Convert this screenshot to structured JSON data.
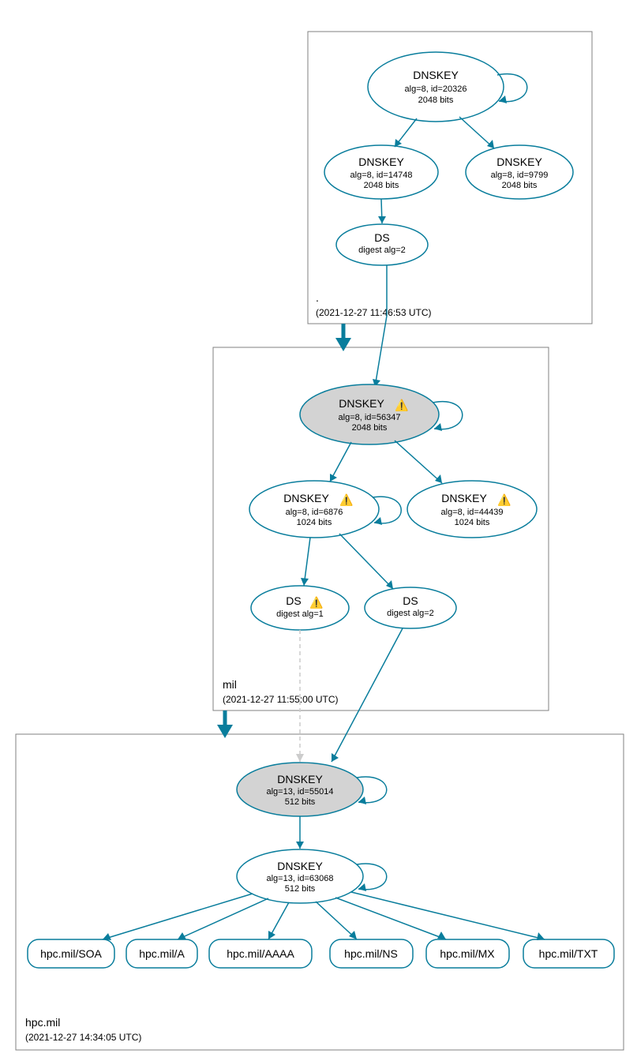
{
  "zones": {
    "root": {
      "label": ".",
      "timestamp": "(2021-12-27 11:46:53 UTC)"
    },
    "mil": {
      "label": "mil",
      "timestamp": "(2021-12-27 11:55:00 UTC)"
    },
    "hpc": {
      "label": "hpc.mil",
      "timestamp": "(2021-12-27 14:34:05 UTC)"
    }
  },
  "nodes": {
    "root_ksk": {
      "title": "DNSKEY",
      "l1": "alg=8, id=20326",
      "l2": "2048 bits",
      "warn": false
    },
    "root_zsk1": {
      "title": "DNSKEY",
      "l1": "alg=8, id=14748",
      "l2": "2048 bits",
      "warn": false
    },
    "root_zsk2": {
      "title": "DNSKEY",
      "l1": "alg=8, id=9799",
      "l2": "2048 bits",
      "warn": false
    },
    "root_ds": {
      "title": "DS",
      "l1": "digest alg=2",
      "l2": "",
      "warn": false
    },
    "mil_ksk": {
      "title": "DNSKEY",
      "l1": "alg=8, id=56347",
      "l2": "2048 bits",
      "warn": true
    },
    "mil_zsk1": {
      "title": "DNSKEY",
      "l1": "alg=8, id=6876",
      "l2": "1024 bits",
      "warn": true
    },
    "mil_zsk2": {
      "title": "DNSKEY",
      "l1": "alg=8, id=44439",
      "l2": "1024 bits",
      "warn": true
    },
    "mil_ds1": {
      "title": "DS",
      "l1": "digest alg=1",
      "l2": "",
      "warn": true
    },
    "mil_ds2": {
      "title": "DS",
      "l1": "digest alg=2",
      "l2": "",
      "warn": false
    },
    "hpc_ksk": {
      "title": "DNSKEY",
      "l1": "alg=13, id=55014",
      "l2": "512 bits",
      "warn": false
    },
    "hpc_zsk": {
      "title": "DNSKEY",
      "l1": "alg=13, id=63068",
      "l2": "512 bits",
      "warn": false
    }
  },
  "rr": {
    "soa": "hpc.mil/SOA",
    "a": "hpc.mil/A",
    "aaaa": "hpc.mil/AAAA",
    "ns": "hpc.mil/NS",
    "mx": "hpc.mil/MX",
    "txt": "hpc.mil/TXT"
  },
  "icons": {
    "warn": "⚠️"
  }
}
